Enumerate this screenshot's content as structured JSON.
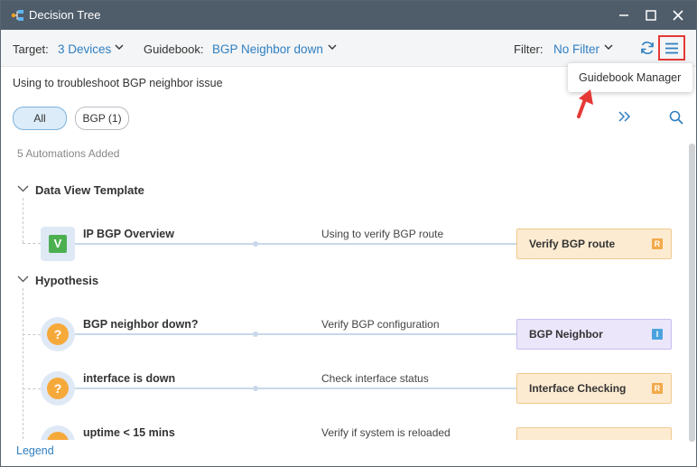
{
  "window": {
    "title": "Decision Tree",
    "colors": {
      "titlebar": "#4f5d6b",
      "accent": "#2f7fc1",
      "highlight": "#e53935"
    }
  },
  "toolbar": {
    "target_label": "Target:",
    "target_value": "3 Devices",
    "guidebook_label": "Guidebook:",
    "guidebook_value": "BGP Neighbor down",
    "filter_label": "Filter:",
    "filter_value": "No Filter",
    "icons": [
      "refresh-icon",
      "menu-icon"
    ]
  },
  "tooltip": {
    "text": "Guidebook Manager"
  },
  "description": "Using to troubleshoot BGP neighbor issue",
  "filters": {
    "all_label": "All",
    "bgp_label": "BGP (1)"
  },
  "count_text": "5 Automations Added",
  "sections": [
    {
      "title": "Data View Template",
      "items": [
        {
          "icon": "V",
          "name": "IP BGP Overview",
          "description": "Using to verify BGP route",
          "card": "Verify BGP route",
          "badge": "R"
        }
      ]
    },
    {
      "title": "Hypothesis",
      "items": [
        {
          "icon": "?",
          "name": "BGP neighbor down?",
          "description": "Verify BGP configuration",
          "card": "BGP Neighbor",
          "badge": "I"
        },
        {
          "icon": "?",
          "name": "interface is down",
          "description": "Check interface status",
          "card": "Interface Checking",
          "badge": "R"
        },
        {
          "icon": "?",
          "name": "uptime < 15 mins",
          "description": "Verify if system is reloaded",
          "card": "",
          "badge": ""
        }
      ]
    }
  ],
  "legend": "Legend"
}
